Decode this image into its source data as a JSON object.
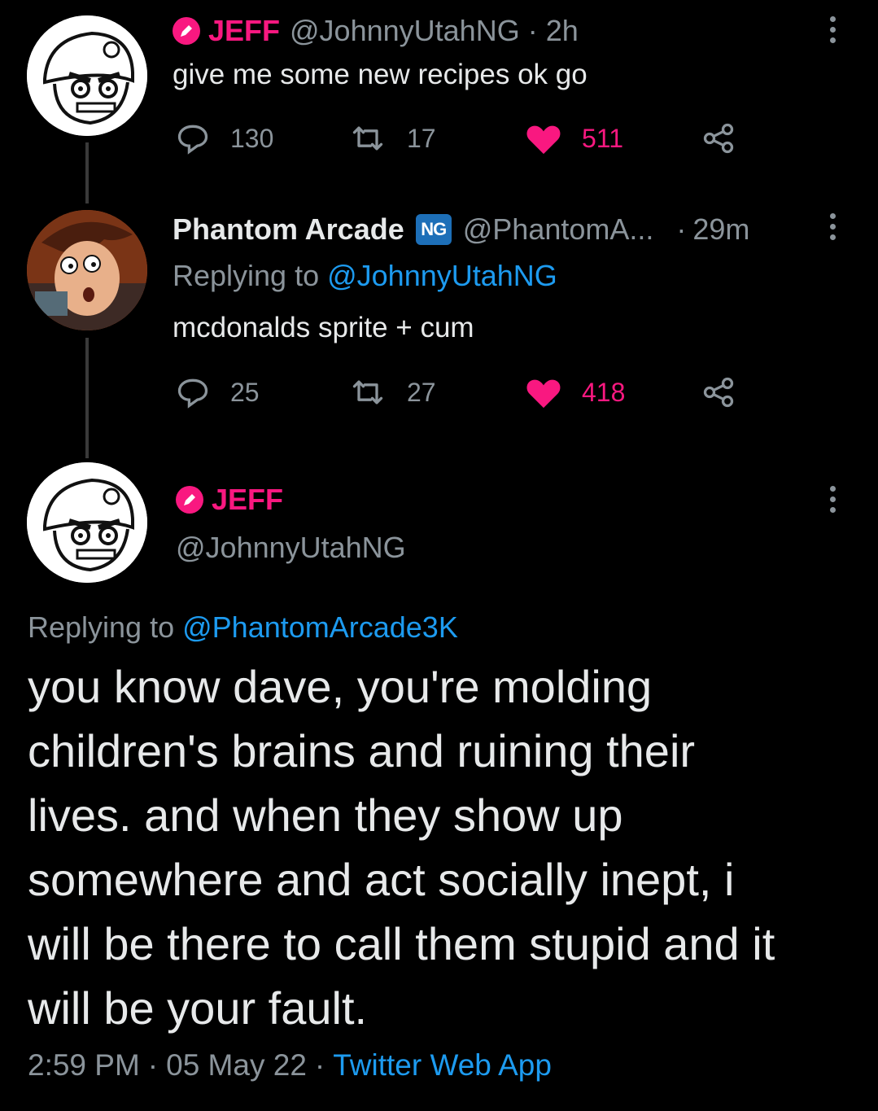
{
  "tweet1": {
    "display_name": "JEFF",
    "handle": "@JohnnyUtahNG",
    "sep": "·",
    "time": "2h",
    "text": "give me some new recipes ok go",
    "replies": "130",
    "retweets": "17",
    "likes": "511"
  },
  "tweet2": {
    "display_name": "Phantom Arcade",
    "badge": "NG",
    "handle": "@PhantomA...",
    "sep": "·",
    "time": "29m",
    "replying_prefix": "Replying to",
    "replying_handle": "@JohnnyUtahNG",
    "text": "mcdonalds sprite + cum",
    "replies": "25",
    "retweets": "27",
    "likes": "418"
  },
  "main_tweet": {
    "display_name": "JEFF",
    "handle": "@JohnnyUtahNG",
    "replying_prefix": "Replying to",
    "replying_handle": "@PhantomArcade3K",
    "text_lines": [
      "you know dave, you're molding",
      "children's brains and ruining their",
      "lives. and when they show up",
      "somewhere and act socially inept, i",
      "will be there to call them stupid and it",
      "will be your fault."
    ],
    "time": "2:59 PM",
    "sep1": "·",
    "date": "05 May 22",
    "sep2": "·",
    "source": "Twitter Web App"
  },
  "colors": {
    "background": "#000000",
    "accent_pink": "#f91880",
    "link_blue": "#1d9bf0",
    "text_secondary": "#8b949b"
  }
}
